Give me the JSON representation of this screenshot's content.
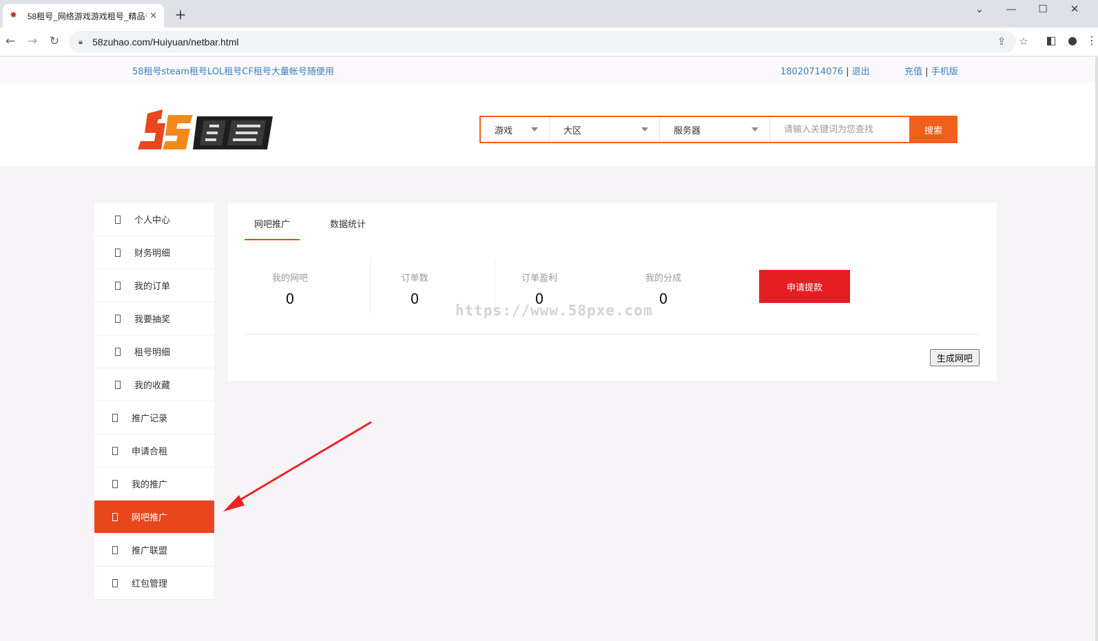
{
  "browser": {
    "tab_title": "58租号_网络游戏游戏租号_精品号",
    "url": "58zuhao.com/Huiyuan/netbar.html"
  },
  "topbar": {
    "slogan": "58租号steam租号LOL租号CF租号大量帐号随便用",
    "phone": "18020714076",
    "separator": "|",
    "logout": "退出",
    "recharge": "充值",
    "mobile": "手机版"
  },
  "search": {
    "game": "游戏",
    "region": "大区",
    "server": "服务器",
    "placeholder": "请输入关键词为您查找",
    "button": "搜索"
  },
  "sidebar": {
    "items": [
      {
        "label": "个人中心"
      },
      {
        "label": "财务明细"
      },
      {
        "label": "我的订单"
      },
      {
        "label": "我要抽奖"
      },
      {
        "label": "租号明细"
      },
      {
        "label": "我的收藏"
      },
      {
        "label": "推广记录"
      },
      {
        "label": "申请合租"
      },
      {
        "label": "我的推广"
      },
      {
        "label": "网吧推广",
        "active": true
      },
      {
        "label": "推广联盟"
      },
      {
        "label": "红包管理"
      }
    ]
  },
  "main": {
    "tabs": [
      {
        "label": "网吧推广",
        "active": true
      },
      {
        "label": "数据统计"
      }
    ],
    "stats": [
      {
        "label": "我的网吧",
        "value": "0"
      },
      {
        "label": "订单数",
        "value": "0"
      },
      {
        "label": "订单盈利",
        "value": "0"
      },
      {
        "label": "我的分成",
        "value": "0"
      }
    ],
    "withdraw_button": "申请提款",
    "generate_button": "生成网吧"
  },
  "watermark": "https://www.58pxe.com",
  "colors": {
    "accent": "#e8461d",
    "search_border": "#f25e1b",
    "withdraw": "#e51e23",
    "link": "#3a80c3"
  }
}
